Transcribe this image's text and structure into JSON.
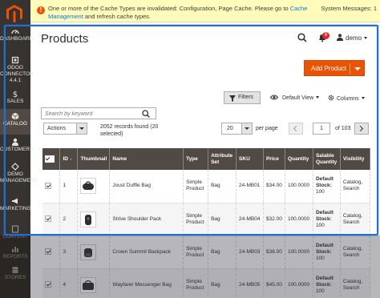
{
  "notice": {
    "message_pre": "One or more of the Cache Types are invalidated: Configuration, Page Cache. Please go to ",
    "link": "Cache Management",
    "message_post": " and refresh cache types.",
    "system_messages": "System Messages: 1"
  },
  "sidebar": {
    "items": [
      {
        "label": "DASHBOARD",
        "icon": "dashboard-icon"
      },
      {
        "label": "ODOO CONNECTOR 4.4.1",
        "icon": "connector-icon"
      },
      {
        "label": "SALES",
        "icon": "dollar-icon"
      },
      {
        "label": "CATALOG",
        "icon": "cube-icon",
        "active": true
      },
      {
        "label": "CUSTOMERS",
        "icon": "person-icon"
      },
      {
        "label": "DEMO MANAGEMENT",
        "icon": "demo-icon"
      },
      {
        "label": "MARKETING",
        "icon": "megaphone-icon"
      },
      {
        "label": "CONTENT",
        "icon": "content-icon"
      },
      {
        "label": "REPORTS",
        "icon": "bar-chart-icon"
      },
      {
        "label": "STORES",
        "icon": "store-icon"
      }
    ]
  },
  "header": {
    "title": "Products",
    "notification_count": "8",
    "user": "demo"
  },
  "toolbar": {
    "add_product": "Add Product",
    "filters": "Filters",
    "view": "Default View",
    "columns": "Columns",
    "search_placeholder": "Search by keyword",
    "actions": "Actions",
    "records": "2052 records found (20 selected)",
    "per_page_value": "20",
    "per_page_label": "per page",
    "current_page": "1",
    "total_pages": "of 103"
  },
  "grid": {
    "columns": [
      "ID",
      "Thumbnail",
      "Name",
      "Type",
      "Attribute Set",
      "SKU",
      "Price",
      "Quantity",
      "Salable Quantity",
      "Visibility"
    ],
    "stock_label": "Default Stock:",
    "rows": [
      {
        "id": "1",
        "name": "Joust Duffle Bag",
        "type": "Simple Product",
        "set": "Bag",
        "sku": "24-MB01",
        "price": "$34.00",
        "qty": "100.0000",
        "salable": "100",
        "visibility": "Catalog, Search"
      },
      {
        "id": "2",
        "name": "Strive Shoulder Pack",
        "type": "Simple Product",
        "set": "Bag",
        "sku": "24-MB04",
        "price": "$32.00",
        "qty": "100.0000",
        "salable": "100",
        "visibility": "Catalog, Search"
      },
      {
        "id": "3",
        "name": "Crown Summit Backpack",
        "type": "Simple Product",
        "set": "Bag",
        "sku": "24-MB03",
        "price": "$38.00",
        "qty": "100.0000",
        "salable": "100",
        "visibility": "Catalog, Search"
      },
      {
        "id": "4",
        "name": "Wayfarer Messenger Bag",
        "type": "Simple Product",
        "set": "Bag",
        "sku": "24-MB05",
        "price": "$45.00",
        "qty": "100.0000",
        "salable": "100",
        "visibility": "Catalog, Search"
      }
    ]
  },
  "colors": {
    "accent": "#eb5202",
    "sidebar": "#373330",
    "grid_header": "#514943",
    "overlay_frame": "#1f6fd8"
  }
}
